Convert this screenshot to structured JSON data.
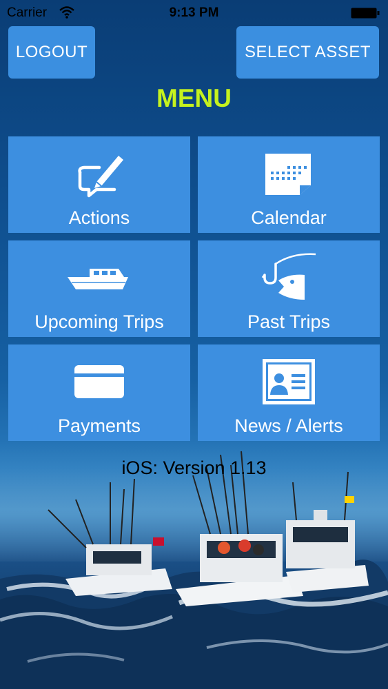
{
  "status_bar": {
    "carrier": "Carrier",
    "time": "9:13 PM"
  },
  "header": {
    "logout_label": "LOGOUT",
    "select_asset_label": "SELECT ASSET",
    "title": "MENU"
  },
  "menu": {
    "tiles": [
      {
        "label": "Actions",
        "icon": "pen-speech-icon"
      },
      {
        "label": "Calendar",
        "icon": "calendar-icon"
      },
      {
        "label": "Upcoming Trips",
        "icon": "boat-icon"
      },
      {
        "label": "Past Trips",
        "icon": "fish-hook-icon"
      },
      {
        "label": "Payments",
        "icon": "credit-card-icon"
      },
      {
        "label": "News / Alerts",
        "icon": "id-card-icon"
      }
    ]
  },
  "footer": {
    "version": "iOS: Version 1.13"
  },
  "colors": {
    "tile_bg": "#3d8fe0",
    "title": "#c6f21e",
    "background": "#0d4a87"
  }
}
